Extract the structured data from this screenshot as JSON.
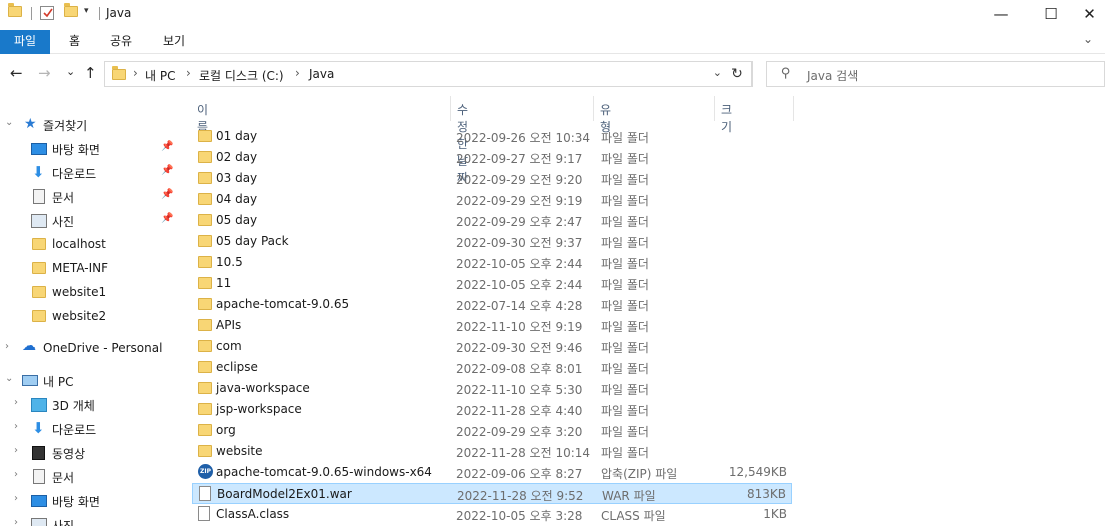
{
  "window": {
    "title": "Java",
    "minimize": "—",
    "maximize": "☐",
    "close": "✕"
  },
  "ribbon": {
    "tabs": [
      "파일",
      "홈",
      "공유",
      "보기"
    ],
    "expand": "⌄"
  },
  "nav": {
    "back": "←",
    "forward": "→",
    "recent": "⌄",
    "up": "↑",
    "breadcrumb": [
      "내 PC",
      "로컬 디스크 (C:)",
      "Java"
    ],
    "crumb_sep": "›",
    "refresh": "↻",
    "search_placeholder": "Java 검색"
  },
  "navpane": {
    "favorites": "즐겨찾기",
    "pinned": [
      "바탕 화면",
      "다운로드",
      "문서",
      "사진"
    ],
    "folders": [
      "localhost",
      "META-INF",
      "website1",
      "website2"
    ],
    "onedrive": "OneDrive - Personal",
    "this_pc": "내 PC",
    "pc_items": [
      "3D 개체",
      "다운로드",
      "동영상",
      "문서",
      "바탕 화면",
      "사진"
    ]
  },
  "columns": {
    "name": "이름",
    "date": "수정한 날짜",
    "type": "유형",
    "size": "크기"
  },
  "colors": {
    "folder": "#f8d675",
    "accent": "#1979ca",
    "selection": "#cce8ff"
  },
  "files": [
    {
      "name": "01 day",
      "date": "2022-09-26 오전 10:34",
      "type": "파일 폴더",
      "size": "",
      "icon": "folder"
    },
    {
      "name": "02 day",
      "date": "2022-09-27 오전 9:17",
      "type": "파일 폴더",
      "size": "",
      "icon": "folder"
    },
    {
      "name": "03 day",
      "date": "2022-09-29 오전 9:20",
      "type": "파일 폴더",
      "size": "",
      "icon": "folder"
    },
    {
      "name": "04 day",
      "date": "2022-09-29 오전 9:19",
      "type": "파일 폴더",
      "size": "",
      "icon": "folder"
    },
    {
      "name": "05 day",
      "date": "2022-09-29 오후 2:47",
      "type": "파일 폴더",
      "size": "",
      "icon": "folder"
    },
    {
      "name": "05 day Pack",
      "date": "2022-09-30 오전 9:37",
      "type": "파일 폴더",
      "size": "",
      "icon": "folder"
    },
    {
      "name": "10.5",
      "date": "2022-10-05 오후 2:44",
      "type": "파일 폴더",
      "size": "",
      "icon": "folder"
    },
    {
      "name": "11",
      "date": "2022-10-05 오후 2:44",
      "type": "파일 폴더",
      "size": "",
      "icon": "folder"
    },
    {
      "name": "apache-tomcat-9.0.65",
      "date": "2022-07-14 오후 4:28",
      "type": "파일 폴더",
      "size": "",
      "icon": "folder"
    },
    {
      "name": "APIs",
      "date": "2022-11-10 오전 9:19",
      "type": "파일 폴더",
      "size": "",
      "icon": "folder"
    },
    {
      "name": "com",
      "date": "2022-09-30 오전 9:46",
      "type": "파일 폴더",
      "size": "",
      "icon": "folder"
    },
    {
      "name": "eclipse",
      "date": "2022-09-08 오후 8:01",
      "type": "파일 폴더",
      "size": "",
      "icon": "folder"
    },
    {
      "name": "java-workspace",
      "date": "2022-11-10 오후 5:30",
      "type": "파일 폴더",
      "size": "",
      "icon": "folder"
    },
    {
      "name": "jsp-workspace",
      "date": "2022-11-28 오후 4:40",
      "type": "파일 폴더",
      "size": "",
      "icon": "folder"
    },
    {
      "name": "org",
      "date": "2022-09-29 오후 3:20",
      "type": "파일 폴더",
      "size": "",
      "icon": "folder"
    },
    {
      "name": "website",
      "date": "2022-11-28 오전 10:14",
      "type": "파일 폴더",
      "size": "",
      "icon": "folder"
    },
    {
      "name": "apache-tomcat-9.0.65-windows-x64",
      "date": "2022-09-06 오후 8:27",
      "type": "압축(ZIP) 파일",
      "size": "12,549KB",
      "icon": "zip",
      "icon_text": "ZIP"
    },
    {
      "name": "BoardModel2Ex01.war",
      "date": "2022-11-28 오전 9:52",
      "type": "WAR 파일",
      "size": "813KB",
      "icon": "file",
      "selected": true
    },
    {
      "name": "ClassA.class",
      "date": "2022-10-05 오후 3:28",
      "type": "CLASS 파일",
      "size": "1KB",
      "icon": "file"
    }
  ]
}
